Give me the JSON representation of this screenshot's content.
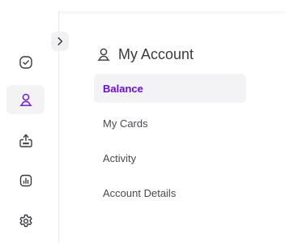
{
  "header": {
    "title": "My Account",
    "icon": "user-icon"
  },
  "sidebar": {
    "items": [
      {
        "name": "tasks",
        "icon": "check-circle-icon",
        "active": false
      },
      {
        "name": "account",
        "icon": "user-icon",
        "active": true
      },
      {
        "name": "transfer",
        "icon": "upload-box-icon",
        "active": false
      },
      {
        "name": "reports",
        "icon": "bar-chart-icon",
        "active": false
      },
      {
        "name": "settings",
        "icon": "gear-icon",
        "active": false
      }
    ],
    "expand_icon": "chevron-right-icon"
  },
  "menu": {
    "items": [
      {
        "label": "Balance",
        "active": true
      },
      {
        "label": "My Cards",
        "active": false
      },
      {
        "label": "Activity",
        "active": false
      },
      {
        "label": "Account Details",
        "active": false
      }
    ]
  },
  "colors": {
    "accent": "#6a0dd9",
    "icon": "#3a3a42",
    "active_bg": "#f3f3f5"
  }
}
